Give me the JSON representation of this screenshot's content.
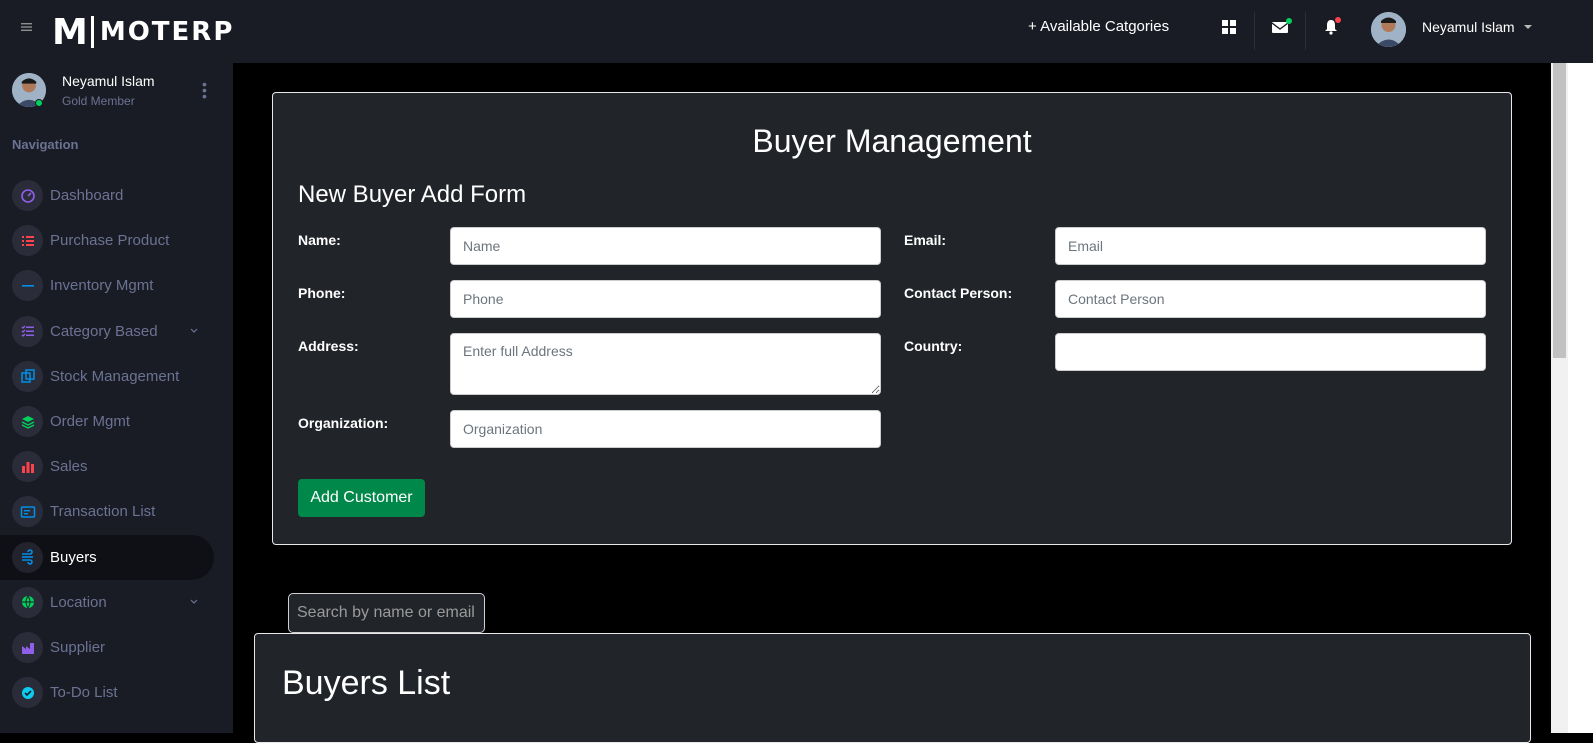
{
  "topbar": {
    "logo_m": "M",
    "logo_rest": "MOTERP",
    "categories_link": "+ Available Catgories",
    "user_name": "Neyamul Islam"
  },
  "sidebar": {
    "profile": {
      "name": "Neyamul Islam",
      "member": "Gold Member"
    },
    "nav_title": "Navigation",
    "items": [
      {
        "label": "Dashboard",
        "icon": "speedometer-icon",
        "color": "#8f5fe8"
      },
      {
        "label": "Purchase Product",
        "icon": "list-icon",
        "color": "#fc424a"
      },
      {
        "label": "Inventory Mgmt",
        "icon": "minus-icon",
        "color": "#0090e7"
      },
      {
        "label": "Category Based",
        "icon": "checklist-icon",
        "color": "#8f5fe8",
        "has_chevron": true
      },
      {
        "label": "Stock Management",
        "icon": "copy-icon",
        "color": "#0090e7"
      },
      {
        "label": "Order Mgmt",
        "icon": "layers-icon",
        "color": "#00d25b"
      },
      {
        "label": "Sales",
        "icon": "bar-chart-icon",
        "color": "#fc424a"
      },
      {
        "label": "Transaction List",
        "icon": "card-icon",
        "color": "#0090e7"
      },
      {
        "label": "Buyers",
        "icon": "wind-icon",
        "color": "#0090e7",
        "active": true
      },
      {
        "label": "Location",
        "icon": "globe-icon",
        "color": "#00d25b",
        "has_chevron": true
      },
      {
        "label": "Supplier",
        "icon": "factory-icon",
        "color": "#8f5fe8"
      },
      {
        "label": "To-Do List",
        "icon": "check-circle-icon",
        "color": "#0dcaf0"
      }
    ]
  },
  "form": {
    "page_title": "Buyer Management",
    "form_title": "New Buyer Add Form",
    "name_label": "Name:",
    "name_placeholder": "Name",
    "email_label": "Email:",
    "email_placeholder": "Email",
    "phone_label": "Phone:",
    "phone_placeholder": "Phone",
    "contact_label": "Contact Person:",
    "contact_placeholder": "Contact Person",
    "address_label": "Address:",
    "address_placeholder": "Enter full Address",
    "country_label": "Country:",
    "organization_label": "Organization:",
    "organization_placeholder": "Organization",
    "submit_label": "Add Customer"
  },
  "list": {
    "search_placeholder": "Search by name or email...",
    "title": "Buyers List"
  }
}
